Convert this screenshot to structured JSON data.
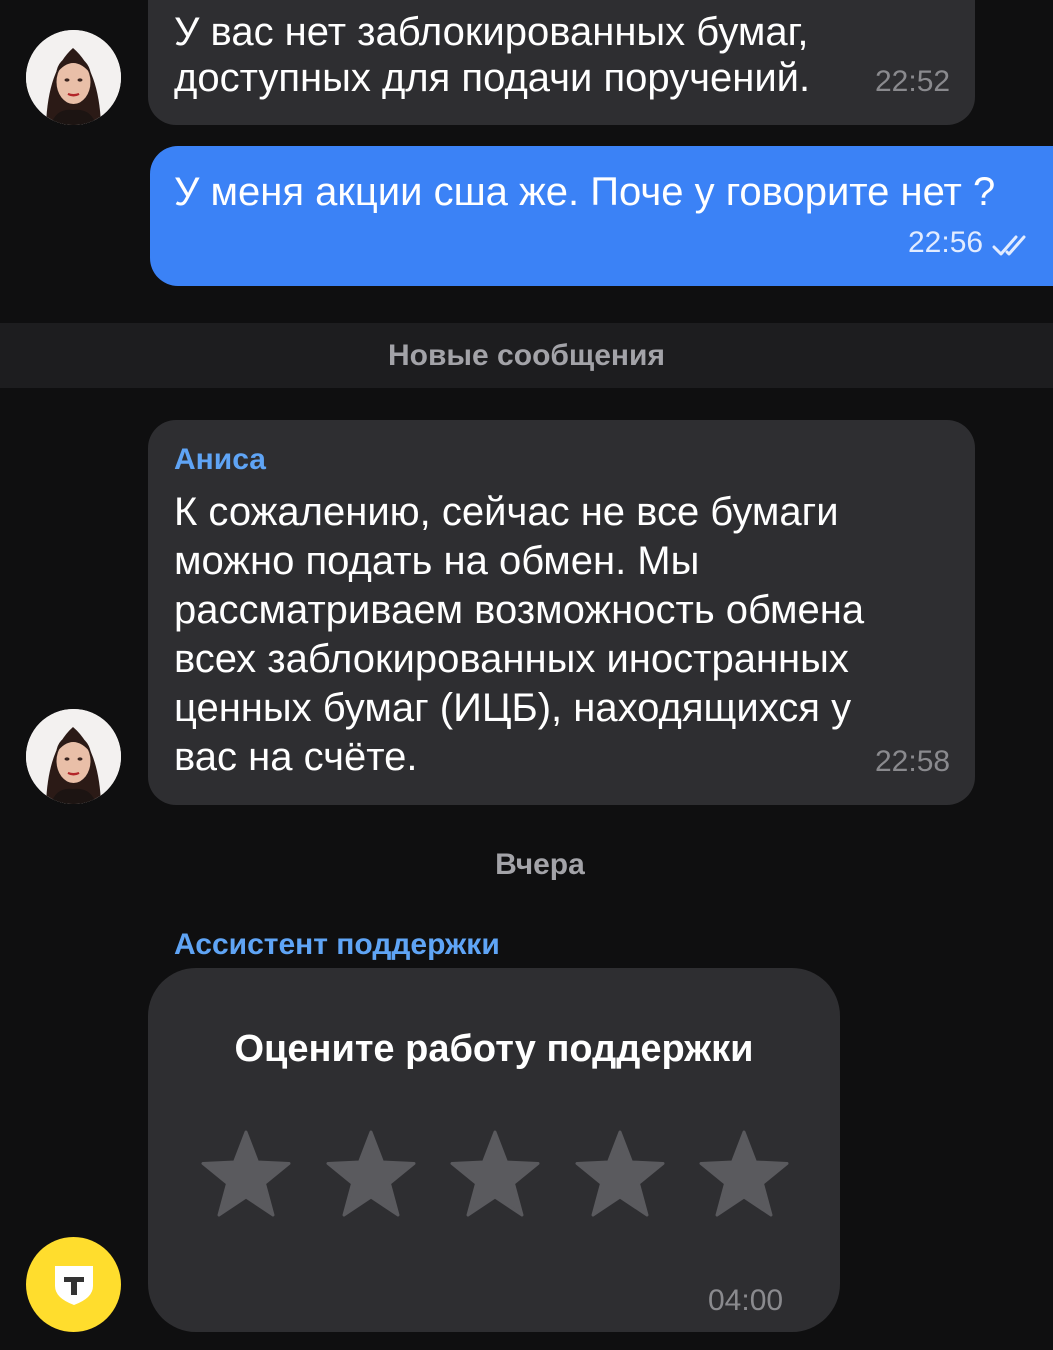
{
  "messages": {
    "first": {
      "text_line1": "У вас нет заблокированных бумаг,",
      "text_line2": "доступных для подачи поручений.",
      "time": "22:52"
    },
    "outgoing": {
      "text": "У меня акции сша же. Поче у говорите нет ?",
      "time": "22:56",
      "status_icon": "double-check-icon"
    },
    "divider": "Новые сообщения",
    "operator": {
      "sender": "Аниса",
      "lines": [
        "К сожалению, сейчас не все бумаги",
        "можно подать на обмен. Мы",
        "рассматриваем возможность обмена",
        "всех заблокированных иностранных",
        "ценных бумаг (ИЦБ), находящихся у",
        "вас на счёте."
      ],
      "time": "22:58"
    },
    "date_label": "Вчера",
    "assistant": {
      "sender": "Ассистент поддержки",
      "rating_title": "Оцените работу поддержки",
      "stars_total": 5,
      "stars_selected": 0,
      "time": "04:00"
    }
  },
  "colors": {
    "background": "#0f0f10",
    "incoming_bubble": "#2e2e31",
    "outgoing_bubble": "#3b82f6",
    "sender_name": "#5fa4f5",
    "bot_avatar": "#ffdd2d",
    "star": "#5a5a5e"
  },
  "icons": {
    "operator_avatar": "operator-photo-avatar",
    "bot_avatar": "t-logo-shield-icon",
    "star": "star-icon"
  }
}
